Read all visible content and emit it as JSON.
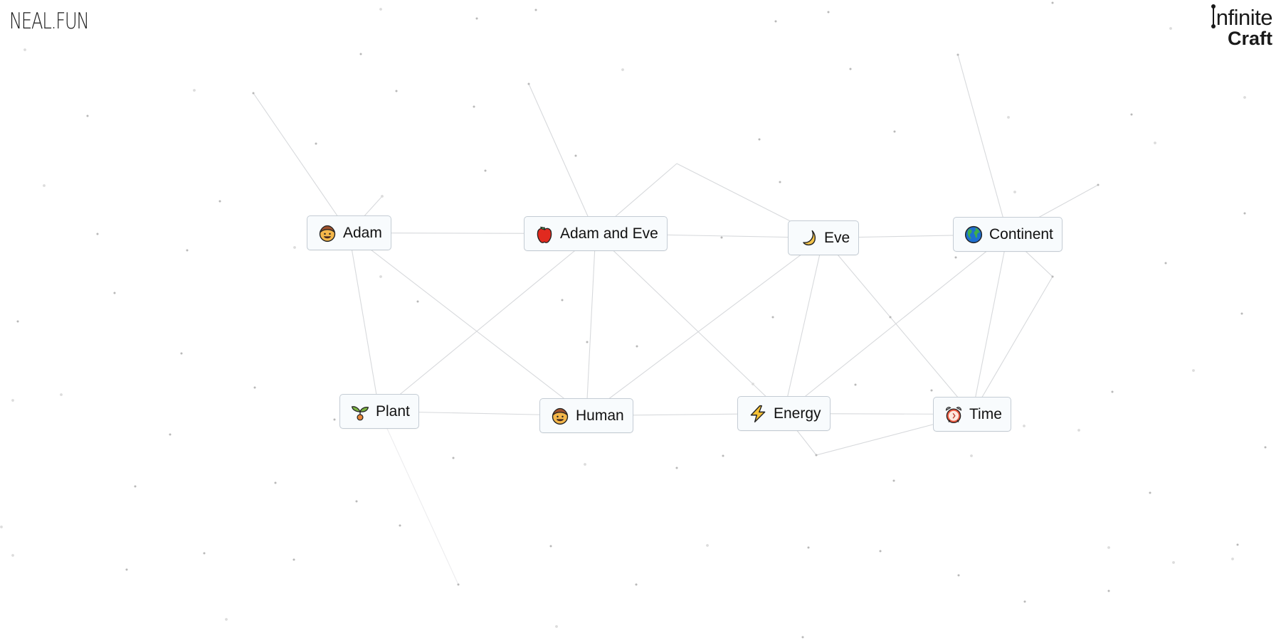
{
  "header": {
    "left_logo": "NEAL.FUN",
    "right_logo_line1": "nfinite",
    "right_logo_line2": "Craft"
  },
  "colors": {
    "background": "#ffffff",
    "item_background": "#f8fbfd",
    "item_border": "#c4ccd4",
    "edge": "#d7d9dc",
    "dot": "#b8b8b8",
    "text": "#111111"
  },
  "canvas": {
    "items": [
      {
        "id": "adam",
        "label": "Adam",
        "icon": "man-face-icon"
      },
      {
        "id": "adam-and-eve",
        "label": "Adam and Eve",
        "icon": "red-apple-icon"
      },
      {
        "id": "eve",
        "label": "Eve",
        "icon": "crescent-moon-icon"
      },
      {
        "id": "continent",
        "label": "Continent",
        "icon": "globe-americas-icon"
      },
      {
        "id": "plant",
        "label": "Plant",
        "icon": "seedling-icon"
      },
      {
        "id": "human",
        "label": "Human",
        "icon": "man-face-icon"
      },
      {
        "id": "energy",
        "label": "Energy",
        "icon": "lightning-bolt-icon"
      },
      {
        "id": "time",
        "label": "Time",
        "icon": "alarm-clock-icon"
      }
    ]
  }
}
